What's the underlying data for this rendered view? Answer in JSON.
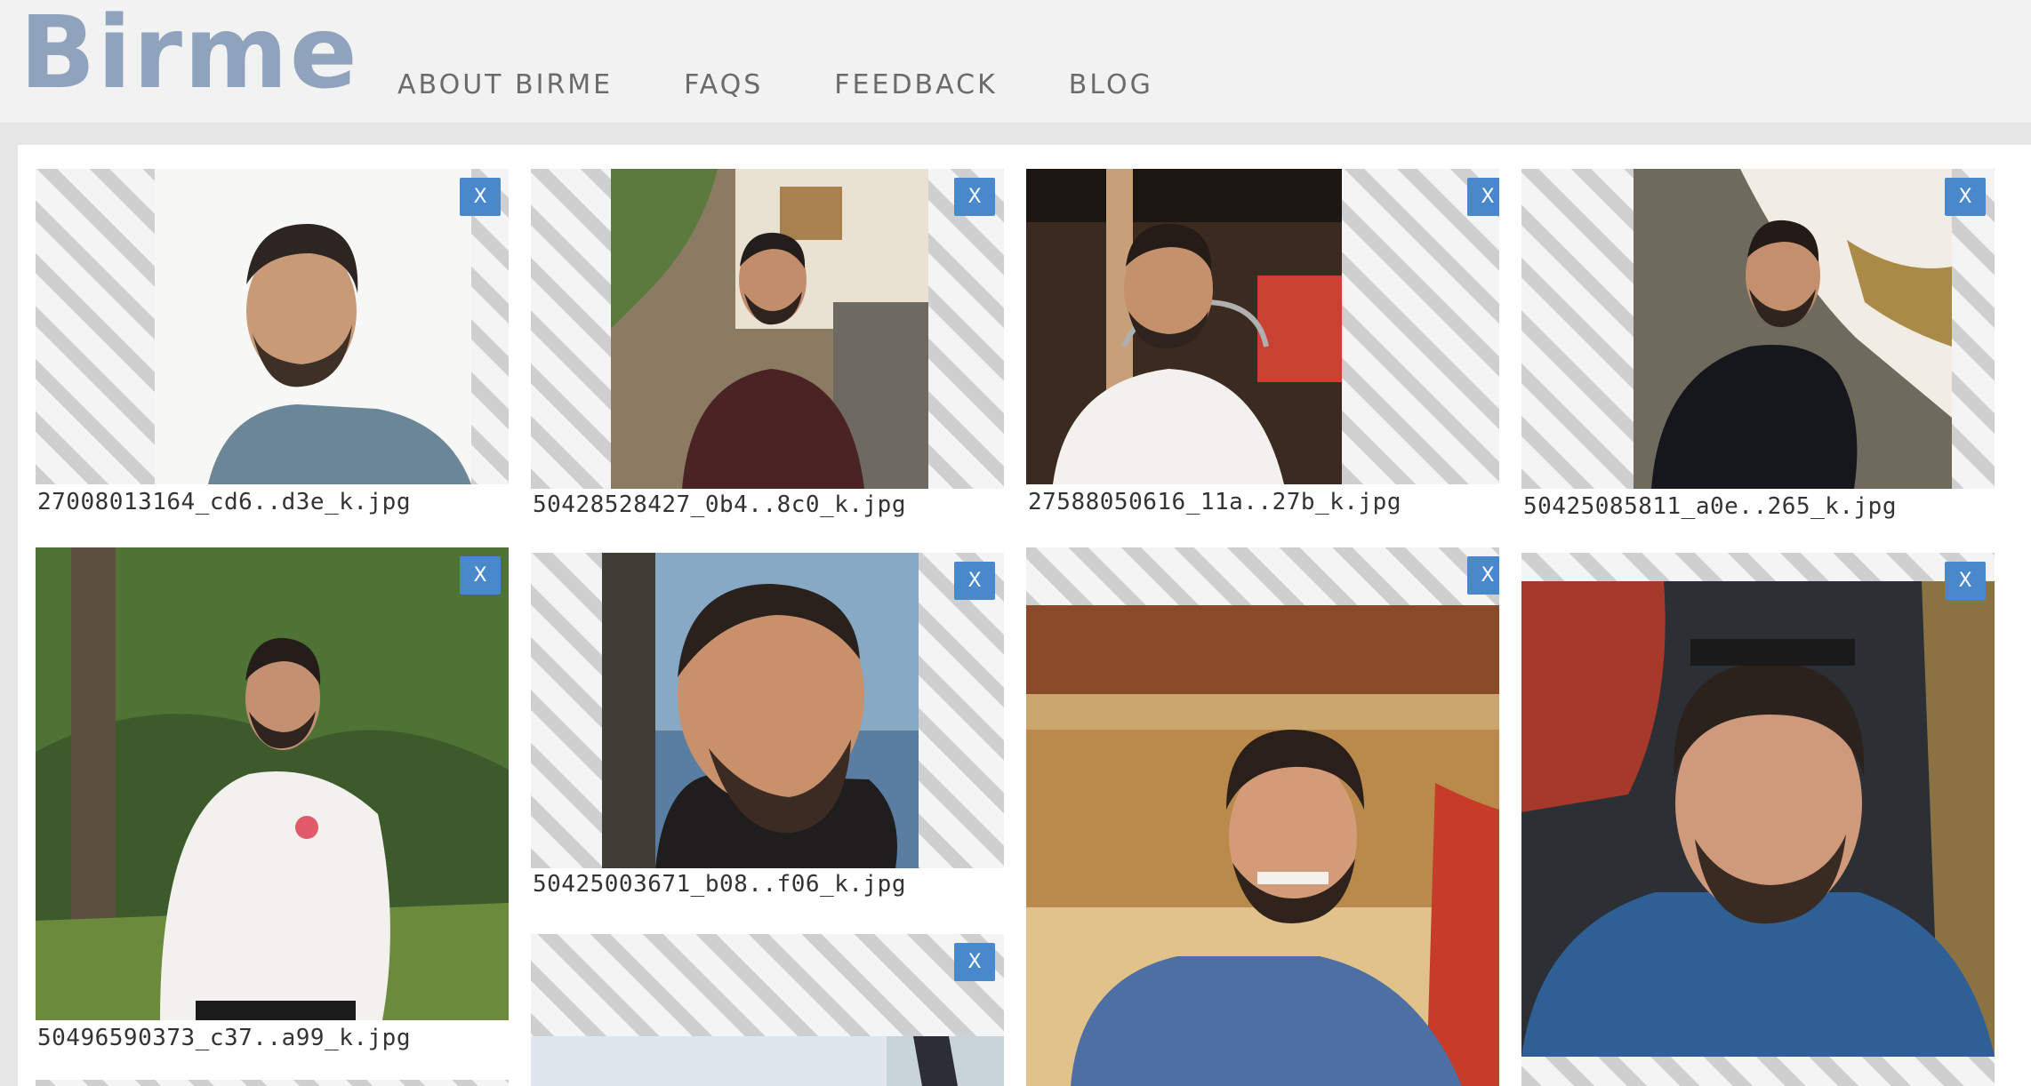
{
  "brand": {
    "logo_text": "Birme",
    "color": "#8fa3bd"
  },
  "nav": {
    "items": [
      {
        "label": "ABOUT BIRME"
      },
      {
        "label": "FAQS"
      },
      {
        "label": "FEEDBACK"
      },
      {
        "label": "BLOG"
      }
    ]
  },
  "gallery": {
    "remove_label": "X",
    "accent_color": "#4a88cc",
    "images": [
      {
        "filename": "27008013164_cd6..d3e_k.jpg"
      },
      {
        "filename": "50428528427_0b4..8c0_k.jpg"
      },
      {
        "filename": "27588050616_11a..27b_k.jpg"
      },
      {
        "filename": "50425085811_a0e..265_k.jpg"
      },
      {
        "filename": "50496590373_c37..a99_k.jpg"
      },
      {
        "filename": "50425003671_b08..f06_k.jpg"
      },
      {
        "filename": ""
      },
      {
        "filename": ""
      },
      {
        "filename": ""
      }
    ]
  }
}
